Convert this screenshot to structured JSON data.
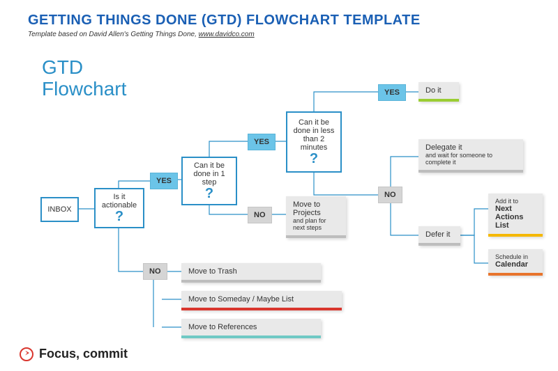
{
  "title": "GETTING THINGS DONE (GTD) FLOWCHART TEMPLATE",
  "subtitle_pre": "Template based on David Allen's Getting Things Done, ",
  "subtitle_link": "www.davidco.com",
  "flowchart_label_l1": "GTD",
  "flowchart_label_l2": "Flowchart",
  "footer": "Focus, commit",
  "nodes": {
    "inbox": "INBOX",
    "actionable": "Is it actionable",
    "one_step": "Can it be done in 1 step",
    "two_min": "Can it be done in less than 2 minutes",
    "projects_l1": "Move to Projects",
    "projects_l2": "and plan for next steps",
    "do_it": "Do it",
    "delegate_l1": "Delegate it",
    "delegate_l2": "and wait for someone to complete it",
    "defer": "Defer it",
    "next_actions_l1": "Add it to",
    "next_actions_l2": "Next Actions List",
    "calendar_l1": "Schedule in",
    "calendar_l2": "Calendar",
    "trash": "Move to Trash",
    "someday": "Move to Someday / Maybe List",
    "references": "Move to References"
  },
  "labels": {
    "yes": "YES",
    "no": "NO",
    "q": "?"
  },
  "colors": {
    "blue": "#2a8fc7",
    "darkblue": "#1a5fb4",
    "yesfill": "#6bc4e8",
    "gray": "#bdbdbd",
    "green": "#9acd32",
    "yellow": "#f5b800",
    "orange": "#e8742c",
    "red": "#d9362e",
    "teal": "#6fc9c4",
    "inbox_accent": "#1a5fb4"
  }
}
